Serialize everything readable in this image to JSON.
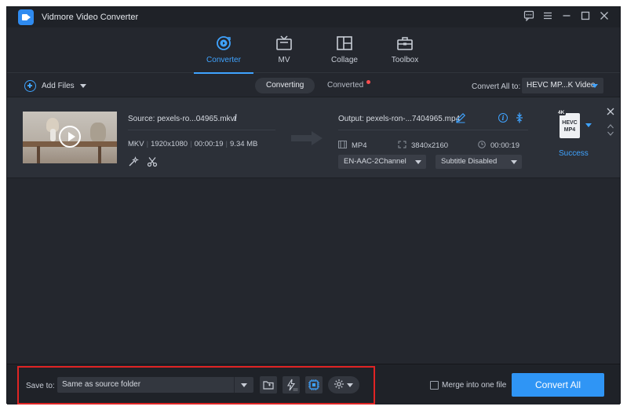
{
  "app": {
    "title": "Vidmore Video Converter"
  },
  "nav": {
    "tabs": [
      {
        "label": "Converter",
        "active": true
      },
      {
        "label": "MV",
        "active": false
      },
      {
        "label": "Collage",
        "active": false
      },
      {
        "label": "Toolbox",
        "active": false
      }
    ]
  },
  "toolbar": {
    "add_files": "Add Files",
    "tab_converting": "Converting",
    "tab_converted": "Converted",
    "convert_all_to_label": "Convert All to:",
    "convert_all_to_value": "HEVC MP...K Video"
  },
  "file": {
    "source_label": "Source: pexels-ro...04965.mkv",
    "format": "MKV",
    "resolution": "1920x1080",
    "duration": "00:00:19",
    "size": "9.34 MB",
    "output_label": "Output: pexels-ron-...7404965.mp4",
    "out_format": "MP4",
    "out_resolution": "3840x2160",
    "out_duration": "00:00:19",
    "audio_track": "EN-AAC-2Channel",
    "subtitle": "Subtitle Disabled",
    "badge_quality": "4K",
    "badge_line1": "HEVC",
    "badge_line2": "MP4",
    "status": "Success"
  },
  "bottom": {
    "save_to_label": "Save to:",
    "save_path": "Same as source folder",
    "merge_label": "Merge into one file",
    "convert_all": "Convert All"
  },
  "colors": {
    "accent": "#3fa3ff",
    "button": "#2f95f5",
    "background": "#24272e",
    "highlight": "#e02424"
  }
}
